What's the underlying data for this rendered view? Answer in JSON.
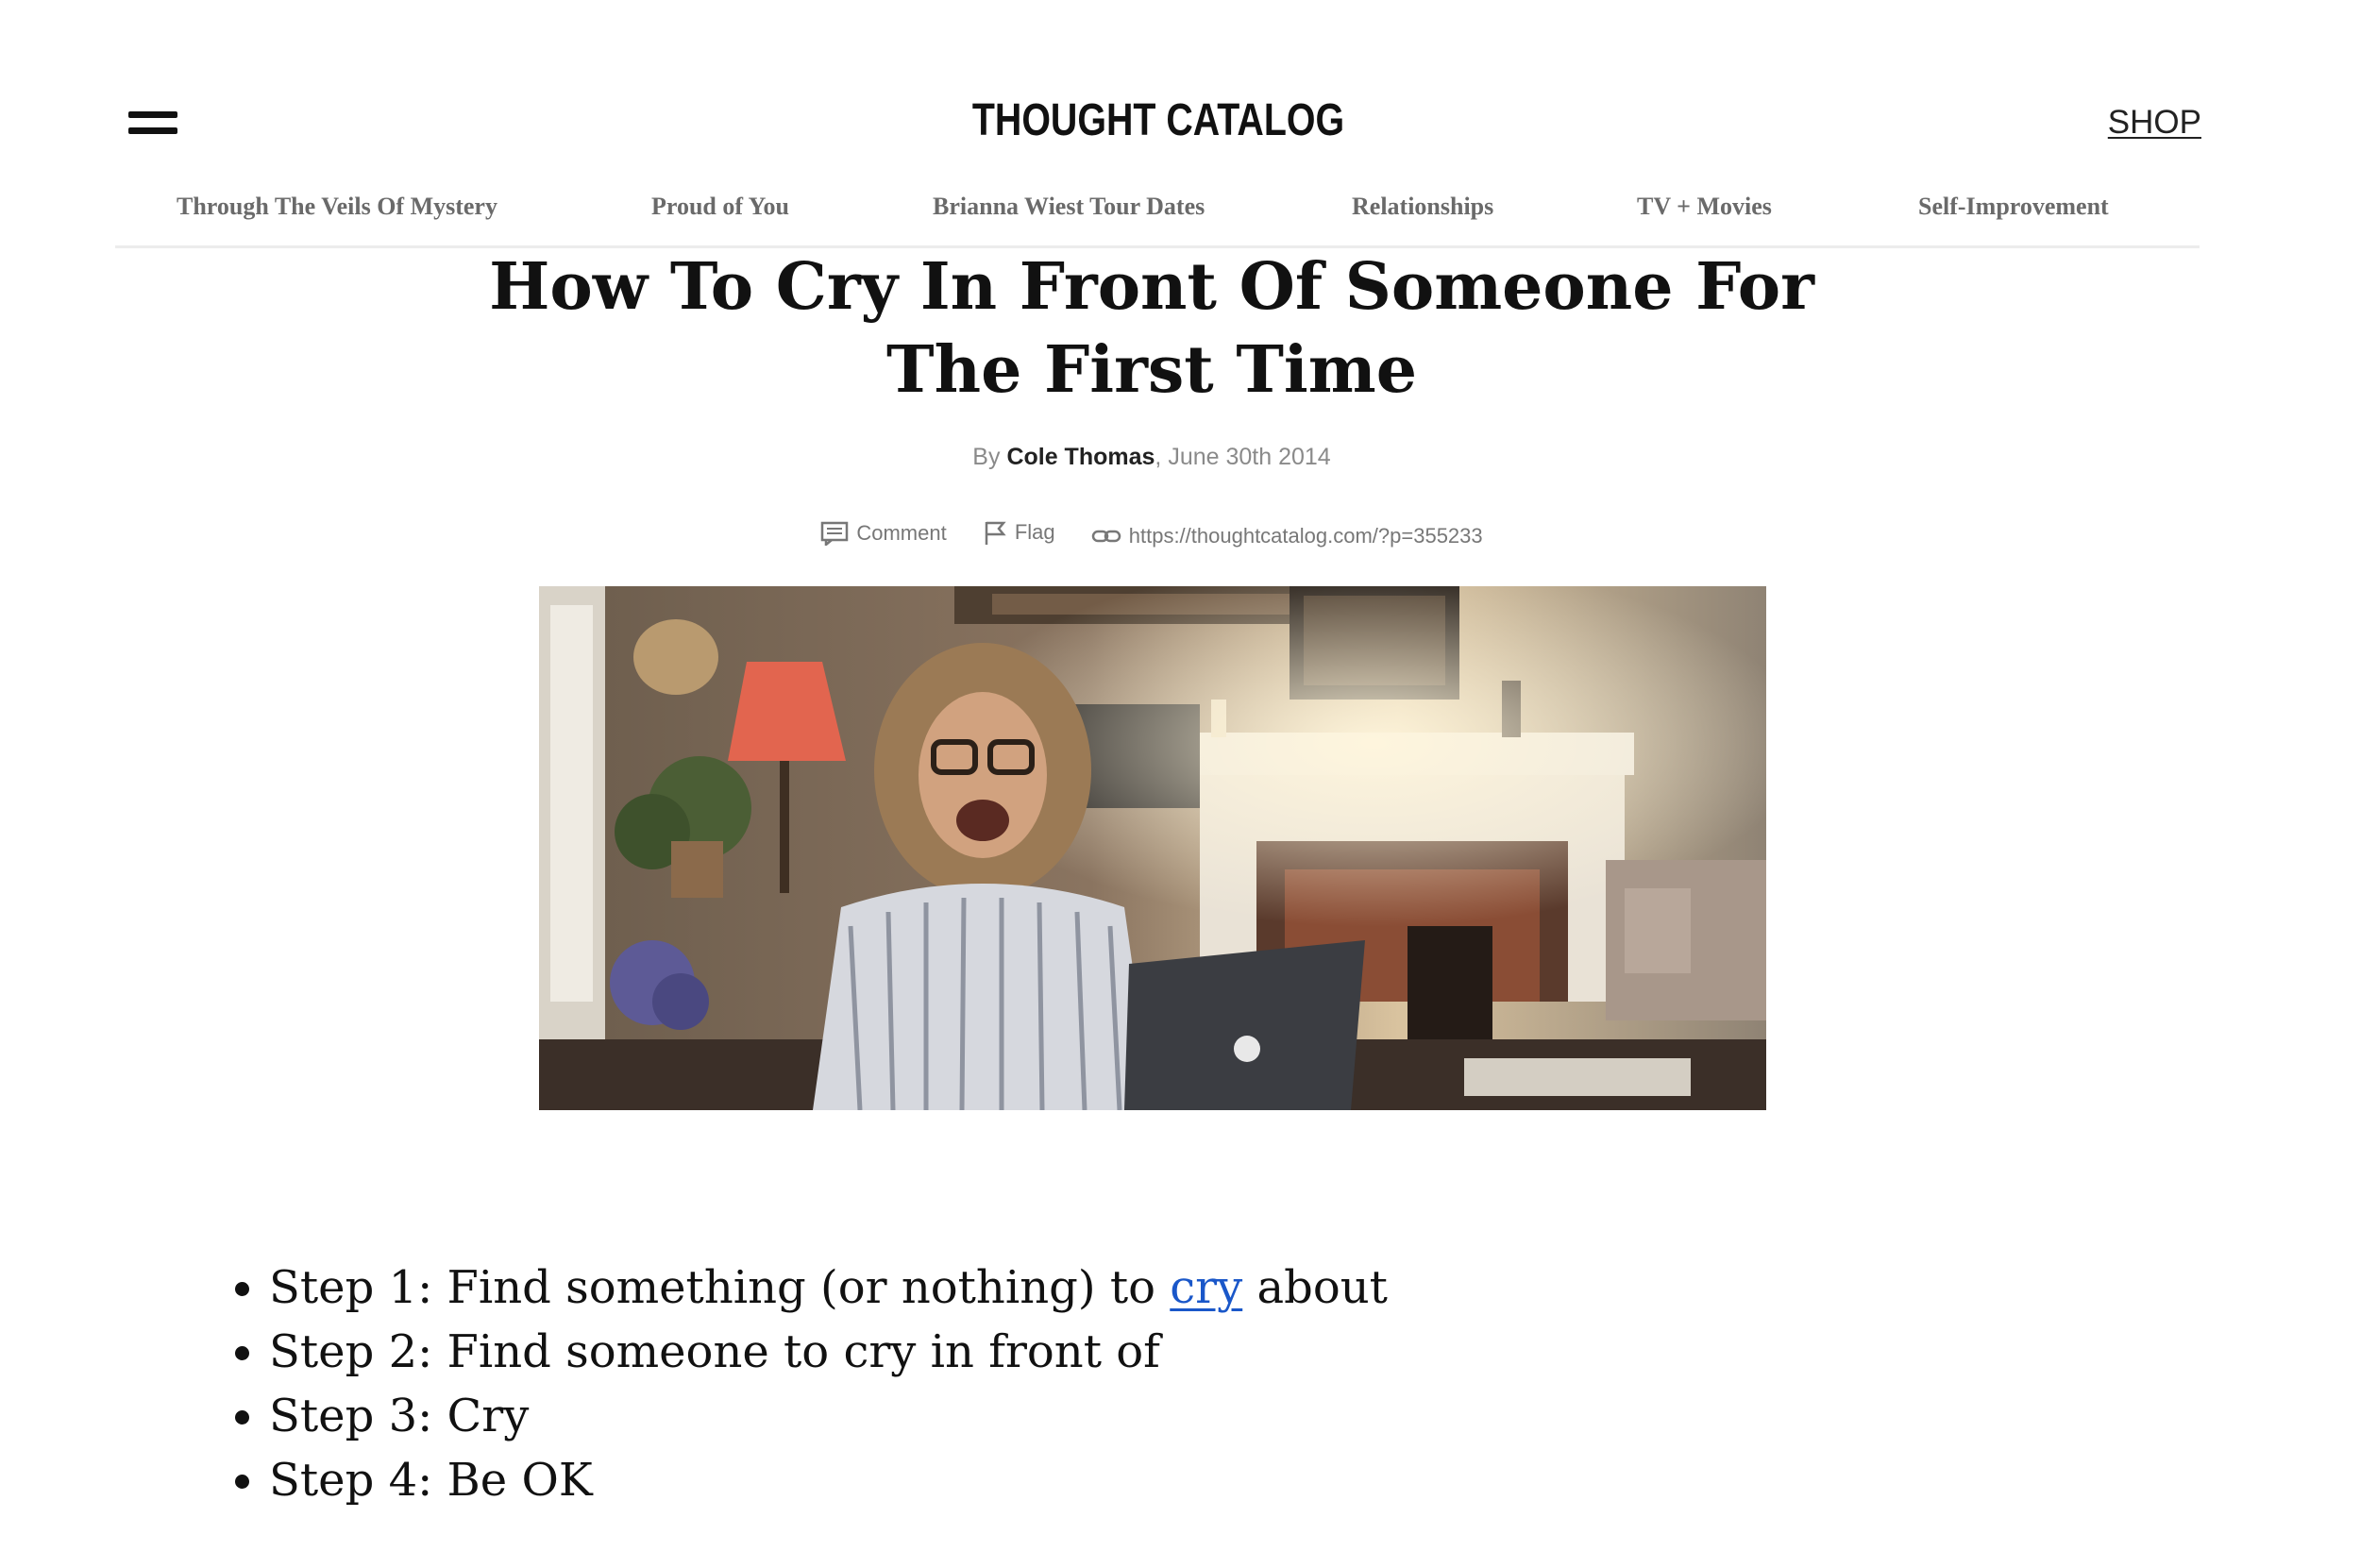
{
  "header": {
    "logo": "THOUGHT CATALOG",
    "shop_label": "SHOP",
    "menu_icon": "hamburger-menu-icon"
  },
  "nav": {
    "items": [
      {
        "label": "Through The Veils Of Mystery"
      },
      {
        "label": "Proud of You"
      },
      {
        "label": "Brianna Wiest Tour Dates"
      },
      {
        "label": "Relationships"
      },
      {
        "label": "TV + Movies"
      },
      {
        "label": "Self-Improvement"
      }
    ]
  },
  "article": {
    "title_line1": "How To Cry In Front Of Someone For",
    "title_line2": "The First Time",
    "byline_prefix": "By",
    "author": "Cole Thomas",
    "date": ", June 30th 2014",
    "actions": {
      "comment": "Comment",
      "flag": "Flag",
      "link": "https://thoughtcatalog.com/?p=355233"
    },
    "steps": [
      {
        "before": "Step 1: Find something (or nothing) to ",
        "link": "cry",
        "after": " about"
      },
      {
        "text": "Step 2: Find someone to cry in front of"
      },
      {
        "text": "Step 3: Cry"
      },
      {
        "text": "Step 4: Be OK"
      }
    ]
  },
  "colors": {
    "link": "#1a57c9",
    "nav_text": "#6a6a6a",
    "meta_text": "#8a8a8a"
  }
}
